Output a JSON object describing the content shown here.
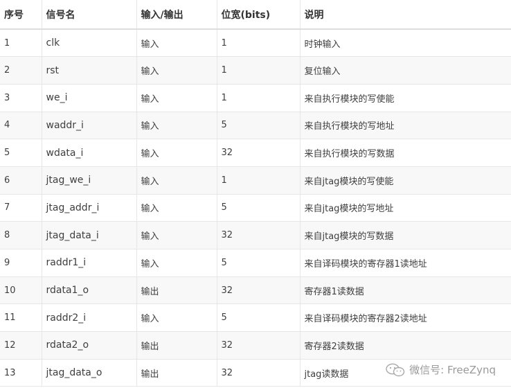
{
  "table": {
    "headers": [
      "序号",
      "信号名",
      "输入/输出",
      "位宽(bits)",
      "说明"
    ],
    "rows": [
      [
        "1",
        "clk",
        "输入",
        "1",
        "时钟输入"
      ],
      [
        "2",
        "rst",
        "输入",
        "1",
        "复位输入"
      ],
      [
        "3",
        "we_i",
        "输入",
        "1",
        "来自执行模块的写使能"
      ],
      [
        "4",
        "waddr_i",
        "输入",
        "5",
        "来自执行模块的写地址"
      ],
      [
        "5",
        "wdata_i",
        "输入",
        "32",
        "来自执行模块的写数据"
      ],
      [
        "6",
        "jtag_we_i",
        "输入",
        "1",
        "来自jtag模块的写使能"
      ],
      [
        "7",
        "jtag_addr_i",
        "输入",
        "5",
        "来自jtag模块的写地址"
      ],
      [
        "8",
        "jtag_data_i",
        "输入",
        "32",
        "来自jtag模块的写数据"
      ],
      [
        "9",
        "raddr1_i",
        "输入",
        "5",
        "来自译码模块的寄存器1读地址"
      ],
      [
        "10",
        "rdata1_o",
        "输出",
        "32",
        "寄存器1读数据"
      ],
      [
        "11",
        "raddr2_i",
        "输入",
        "5",
        "来自译码模块的寄存器2读地址"
      ],
      [
        "12",
        "rdata2_o",
        "输出",
        "32",
        "寄存器2读数据"
      ],
      [
        "13",
        "jtag_data_o",
        "输出",
        "32",
        "jtag读数据"
      ]
    ]
  },
  "watermark": {
    "text": "微信号: FreeZynq",
    "icon": "wechat-icon"
  }
}
